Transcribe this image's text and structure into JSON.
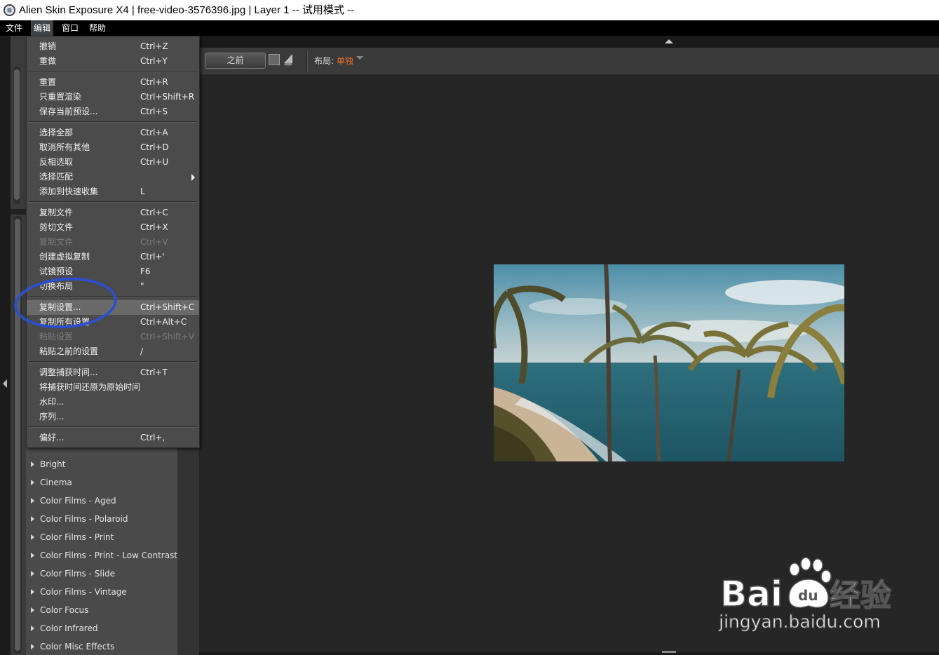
{
  "window": {
    "title": "Alien Skin Exposure X4 | free-video-3576396.jpg | Layer 1 -- 试用模式 --"
  },
  "menubar": {
    "items": [
      {
        "label": "文件"
      },
      {
        "label": "编辑",
        "active": true
      },
      {
        "label": "窗口"
      },
      {
        "label": "帮助"
      }
    ]
  },
  "toolbar": {
    "before_label": "之前",
    "layout_label": "布局:",
    "layout_value": "单独",
    "accent_color": "#e86a2c"
  },
  "edit_menu": {
    "items": [
      {
        "label": "撤销",
        "shortcut": "Ctrl+Z"
      },
      {
        "label": "重做",
        "shortcut": "Ctrl+Y"
      },
      {
        "label": "重置",
        "shortcut": "Ctrl+R"
      },
      {
        "label": "只重置渲染",
        "shortcut": "Ctrl+Shift+R"
      },
      {
        "label": "保存当前预设...",
        "shortcut": "Ctrl+S"
      },
      {
        "label": "选择全部",
        "shortcut": "Ctrl+A"
      },
      {
        "label": "取消所有其他",
        "shortcut": "Ctrl+D"
      },
      {
        "label": "反相选取",
        "shortcut": "Ctrl+U"
      },
      {
        "label": "选择匹配",
        "shortcut": "",
        "submenu": true
      },
      {
        "label": "添加到快速收集",
        "shortcut": "L"
      },
      {
        "label": "复制文件",
        "shortcut": "Ctrl+C"
      },
      {
        "label": "剪切文件",
        "shortcut": "Ctrl+X"
      },
      {
        "label": "复制文件",
        "shortcut": "Ctrl+V",
        "disabled": true
      },
      {
        "label": "创建虚拟复制",
        "shortcut": "Ctrl+'"
      },
      {
        "label": "试镜预设",
        "shortcut": "F6"
      },
      {
        "label": "切换布局",
        "shortcut": "\""
      },
      {
        "label": "复制设置...",
        "shortcut": "Ctrl+Shift+C",
        "highlighted": true
      },
      {
        "label": "复制所有设置",
        "shortcut": "Ctrl+Alt+C"
      },
      {
        "label": "粘贴设置",
        "shortcut": "Ctrl+Shift+V",
        "disabled": true
      },
      {
        "label": "粘贴之前的设置",
        "shortcut": "/"
      },
      {
        "label": "调整捕获时间...",
        "shortcut": "Ctrl+T"
      },
      {
        "label": "将捕获时间还原为原始时间",
        "shortcut": ""
      },
      {
        "label": "水印...",
        "shortcut": ""
      },
      {
        "label": "序列...",
        "shortcut": ""
      },
      {
        "label": "偏好...",
        "shortcut": "Ctrl+,"
      }
    ]
  },
  "presets": {
    "items": [
      {
        "label": "Bright"
      },
      {
        "label": "Cinema"
      },
      {
        "label": "Color Films - Aged"
      },
      {
        "label": "Color Films - Polaroid"
      },
      {
        "label": "Color Films - Print"
      },
      {
        "label": "Color Films - Print - Low Contrast"
      },
      {
        "label": "Color Films - Slide"
      },
      {
        "label": "Color Films - Vintage"
      },
      {
        "label": "Color Focus"
      },
      {
        "label": "Color Infrared"
      },
      {
        "label": "Color Misc Effects"
      }
    ]
  },
  "annotation": {
    "color": "#2d4fcc"
  },
  "watermark": {
    "logo_text": "Bai",
    "logo_suffix": "经验",
    "url": "jingyan.baidu.com"
  }
}
